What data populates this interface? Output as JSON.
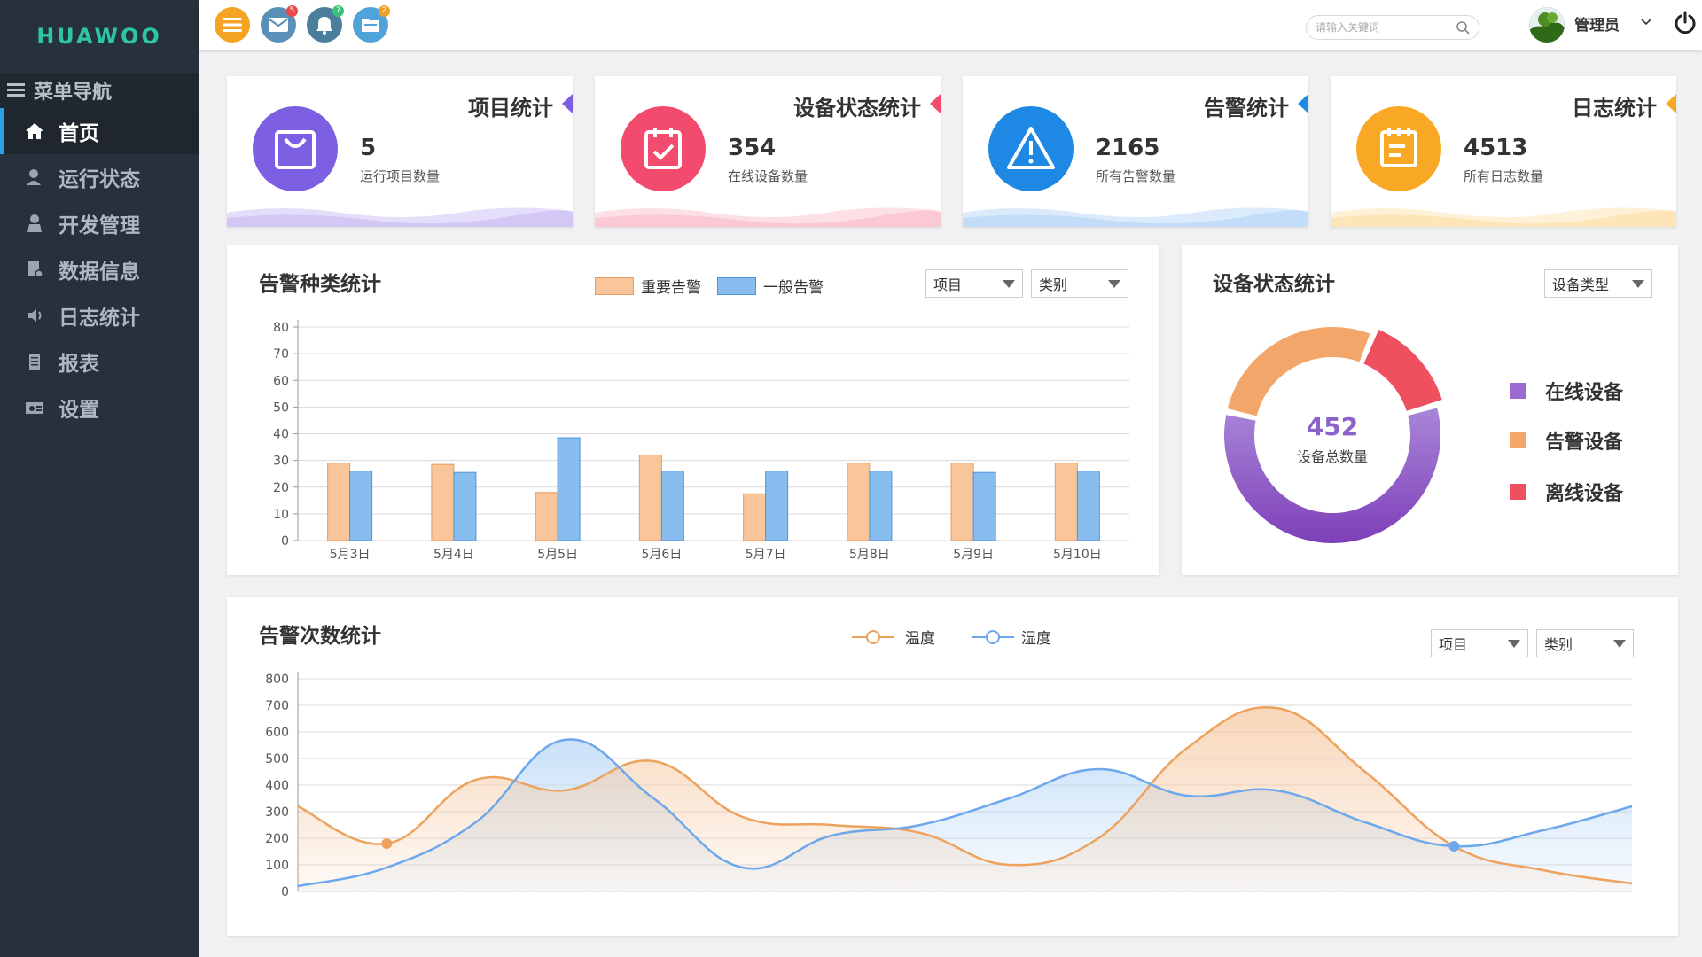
{
  "app": {
    "logo": "HUAWOO"
  },
  "sidebar": {
    "header": "菜单导航",
    "items": [
      {
        "label": "首页",
        "icon": "home-icon",
        "active": true
      },
      {
        "label": "运行状态",
        "icon": "user-status-icon"
      },
      {
        "label": "开发管理",
        "icon": "developer-icon"
      },
      {
        "label": "数据信息",
        "icon": "data-document-icon"
      },
      {
        "label": "日志统计",
        "icon": "speaker-icon"
      },
      {
        "label": "报表",
        "icon": "report-icon"
      },
      {
        "label": "设置",
        "icon": "settings-icon"
      }
    ]
  },
  "header": {
    "icons": [
      {
        "name": "menu-icon",
        "color": "#f4a322",
        "badge": ""
      },
      {
        "name": "mail-icon",
        "color": "#5a8fb8",
        "badge": "5",
        "badge_color": "#e84a4a"
      },
      {
        "name": "bell-icon",
        "color": "#4a7e9a",
        "badge": "7",
        "badge_color": "#3cbf7a"
      },
      {
        "name": "folder-icon",
        "color": "#4fa3d8",
        "badge": "2",
        "badge_color": "#f0a020"
      }
    ],
    "search_placeholder": "请输入关键词",
    "username": "管理员"
  },
  "stats": [
    {
      "title": "项目统计",
      "value": "5",
      "desc": "运行项目数量",
      "color": "#7d5fe3",
      "icon": "bag-icon"
    },
    {
      "title": "设备状态统计",
      "value": "354",
      "desc": "在线设备数量",
      "color": "#f24b6e",
      "icon": "calendar-check-icon"
    },
    {
      "title": "告警统计",
      "value": "2165",
      "desc": "所有告警数量",
      "color": "#1e88e5",
      "icon": "warning-icon"
    },
    {
      "title": "日志统计",
      "value": "4513",
      "desc": "所有日志数量",
      "color": "#f9a825",
      "icon": "notepad-icon"
    }
  ],
  "alarm_type": {
    "title": "告警种类统计",
    "select1": "项目",
    "select2": "类别"
  },
  "device_status": {
    "title": "设备状态统计",
    "select": "设备类型",
    "center_value": "452",
    "center_label": "设备总数量"
  },
  "alarm_count": {
    "title": "告警次数统计",
    "select1": "项目",
    "select2": "类别"
  },
  "chart_data": [
    {
      "type": "bar",
      "categories": [
        "5月3日",
        "5月4日",
        "5月5日",
        "5月6日",
        "5月7日",
        "5月8日",
        "5月9日",
        "5月10日"
      ],
      "series": [
        {
          "name": "重要告警",
          "values": [
            29,
            28.5,
            18,
            32,
            17.5,
            29,
            29,
            29
          ],
          "color": "#f9c59a",
          "stroke": "#e99a5c"
        },
        {
          "name": "一般告警",
          "values": [
            26,
            25.5,
            38.5,
            26,
            26,
            26,
            25.5,
            26
          ],
          "color": "#86bdee",
          "stroke": "#4e95d8"
        }
      ],
      "ylim": [
        0,
        80
      ],
      "yticks": [
        0,
        10,
        20,
        30,
        40,
        50,
        60,
        70,
        80
      ]
    },
    {
      "type": "pie",
      "categories": [
        "在线设备",
        "告警设备",
        "离线设备"
      ],
      "values": [
        262,
        125,
        65
      ],
      "colors": [
        "#9a6ad0",
        "#f2a66a",
        "#ee5060"
      ]
    },
    {
      "type": "area",
      "x": [
        0,
        1,
        2,
        3,
        4,
        5,
        6,
        7,
        8,
        9,
        10,
        11,
        12,
        13,
        14,
        15
      ],
      "series": [
        {
          "name": "温度",
          "values": [
            320,
            180,
            420,
            380,
            490,
            280,
            250,
            220,
            100,
            200,
            540,
            690,
            450,
            170,
            80,
            30
          ],
          "color": "#eda25e"
        },
        {
          "name": "湿度",
          "values": [
            20,
            90,
            260,
            570,
            350,
            90,
            210,
            250,
            350,
            460,
            360,
            380,
            260,
            170,
            230,
            320
          ],
          "color": "#6ea8ec"
        }
      ],
      "ylim": [
        0,
        800
      ],
      "yticks": [
        0,
        100,
        200,
        300,
        400,
        500,
        600,
        700,
        800
      ]
    }
  ]
}
